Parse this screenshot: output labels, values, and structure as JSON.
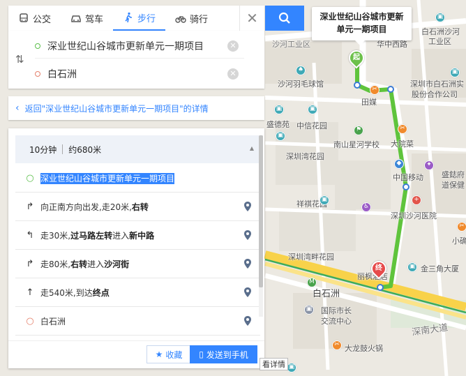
{
  "modes": [
    {
      "label": "公交",
      "icon": "bus-icon",
      "active": false
    },
    {
      "label": "驾车",
      "icon": "car-icon",
      "active": false
    },
    {
      "label": "步行",
      "icon": "walk-icon",
      "active": true
    },
    {
      "label": "骑行",
      "icon": "bike-icon",
      "active": false
    }
  ],
  "route": {
    "origin": "深业世纪山谷城市更新单元一期项目",
    "destination": "白石洲"
  },
  "back_link": "返回\"深业世纪山谷城市更新单元一期项目\"的详情",
  "summary": {
    "time": "10分钟",
    "distance": "约680米"
  },
  "steps": [
    {
      "icon": "start-dot-icon",
      "parts": [
        {
          "text": "深业世纪山谷城市更新单元一期项目",
          "bold": false,
          "highlight": true
        }
      ]
    },
    {
      "icon": "turn-right-icon",
      "parts": [
        {
          "text": "向正南方向出发,走20米,",
          "bold": false
        },
        {
          "text": "右转",
          "bold": true
        }
      ]
    },
    {
      "icon": "cross-left-icon",
      "parts": [
        {
          "text": "走30米,",
          "bold": false
        },
        {
          "text": "过马路左转",
          "bold": true
        },
        {
          "text": "进入",
          "bold": false
        },
        {
          "text": "新中路",
          "bold": true
        }
      ]
    },
    {
      "icon": "turn-right-icon",
      "parts": [
        {
          "text": "走80米,",
          "bold": false
        },
        {
          "text": "右转",
          "bold": true
        },
        {
          "text": "进入",
          "bold": false
        },
        {
          "text": "沙河街",
          "bold": true
        }
      ]
    },
    {
      "icon": "straight-icon",
      "parts": [
        {
          "text": "走540米,到达",
          "bold": false
        },
        {
          "text": "终点",
          "bold": true
        }
      ]
    },
    {
      "icon": "end-dot-icon",
      "parts": [
        {
          "text": "白石洲",
          "bold": false
        }
      ]
    }
  ],
  "buttons": {
    "favorite": "收藏",
    "send_to_phone": "发送到手机"
  },
  "edge_tab": "看详情",
  "map": {
    "callout": "深业世纪山谷城市更新单元一期项目",
    "start_marker": "起",
    "end_marker": "终",
    "labels": [
      {
        "text": "白石洲沙河",
        "cls": ""
      },
      {
        "text": "工业区",
        "cls": ""
      },
      {
        "text": "沙河工业区",
        "cls": "road"
      },
      {
        "text": "华中西路",
        "cls": ""
      },
      {
        "text": "沙河羽毛球馆",
        "cls": ""
      },
      {
        "text": "深圳市白石洲实",
        "cls": ""
      },
      {
        "text": "股份合作公司",
        "cls": ""
      },
      {
        "text": "田媒",
        "cls": ""
      },
      {
        "text": "盛德苑",
        "cls": ""
      },
      {
        "text": "中信花园",
        "cls": ""
      },
      {
        "text": "南山星河学校",
        "cls": ""
      },
      {
        "text": "大院菜",
        "cls": ""
      },
      {
        "text": "深圳湾花园",
        "cls": ""
      },
      {
        "text": "盛鋕府",
        "cls": ""
      },
      {
        "text": "中国移动",
        "cls": ""
      },
      {
        "text": "道保健",
        "cls": ""
      },
      {
        "text": "祥祺花园",
        "cls": ""
      },
      {
        "text": "深圳沙河医院",
        "cls": ""
      },
      {
        "text": "小确",
        "cls": ""
      },
      {
        "text": "深圳湾畔花园",
        "cls": ""
      },
      {
        "text": "金三角大厦",
        "cls": ""
      },
      {
        "text": "丽枫酒店",
        "cls": ""
      },
      {
        "text": "白石洲",
        "cls": "big"
      },
      {
        "text": "国际市长",
        "cls": ""
      },
      {
        "text": "交流中心",
        "cls": ""
      },
      {
        "text": "深南大道",
        "cls": "road"
      },
      {
        "text": "大龙鼓火锅",
        "cls": ""
      }
    ]
  },
  "colors": {
    "accent": "#3385ff",
    "route": "#5fc43c"
  }
}
